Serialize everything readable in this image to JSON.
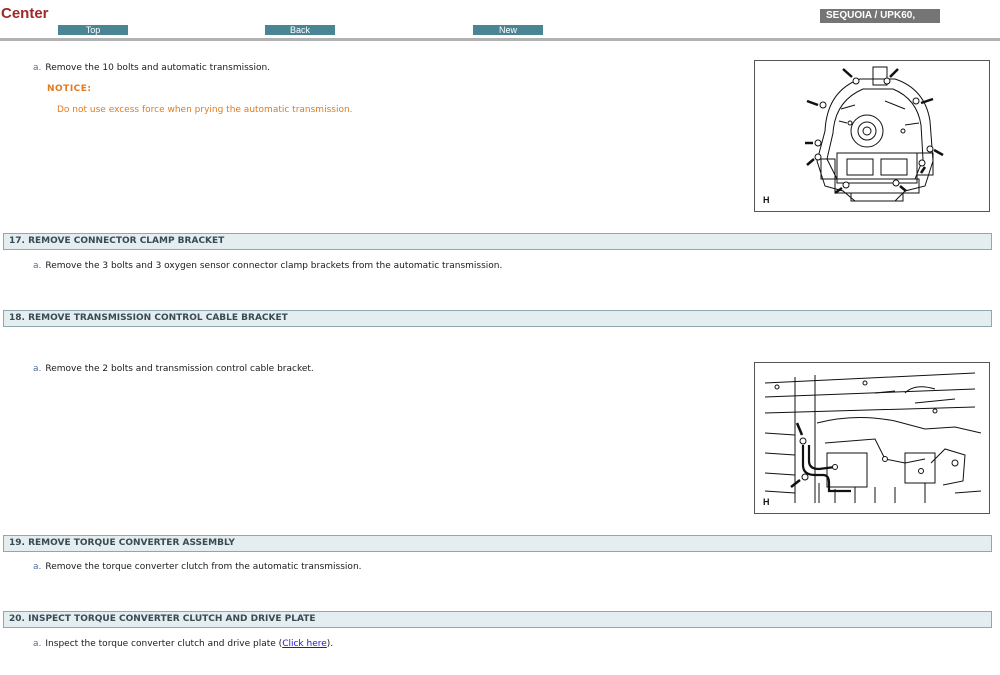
{
  "header": {
    "brand": "Center",
    "nav": {
      "top": "Top",
      "back": "Back",
      "new": "New"
    },
    "model": "SEQUOIA / UPK60,"
  },
  "step16": {
    "step_a": "Remove the 10 bolts and automatic transmission.",
    "notice_label": "NOTICE:",
    "notice_text": "Do not use excess force when prying the automatic transmission.",
    "figure_label": "H"
  },
  "sections": [
    {
      "title": "17. REMOVE CONNECTOR CLAMP BRACKET",
      "step_a": "Remove the 3 bolts and 3 oxygen sensor connector clamp brackets from the automatic transmission."
    },
    {
      "title": "18. REMOVE TRANSMISSION CONTROL CABLE BRACKET",
      "step_a": "Remove the 2 bolts and transmission control cable bracket.",
      "figure_label": "H"
    },
    {
      "title": "19. REMOVE TORQUE CONVERTER ASSEMBLY",
      "step_a": "Remove the torque converter clutch from the automatic transmission."
    },
    {
      "title": "20. INSPECT TORQUE CONVERTER CLUTCH AND DRIVE PLATE",
      "step_a_before": "Inspect the torque converter clutch and drive plate (",
      "step_a_link": "Click here",
      "step_a_after": ")."
    }
  ],
  "step_marker": "a.",
  "colors": {
    "brand": "#a02828",
    "nav_button": "#4b8593",
    "notice": "#e07b1e",
    "section_bg": "#e4eef1",
    "link": "#1a1acc"
  }
}
